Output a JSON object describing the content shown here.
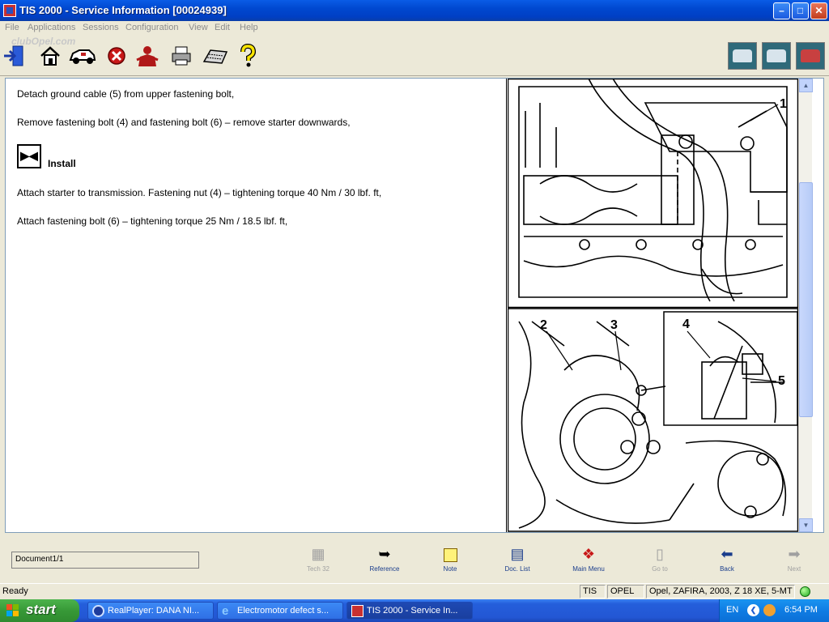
{
  "window": {
    "title": "TIS 2000 - Service Information [00024939]",
    "controls": {
      "minimize": "–",
      "maximize": "□",
      "close": "✕"
    }
  },
  "menu": [
    "File",
    "Applications",
    "Sessions",
    "Configuration",
    "View",
    "Edit",
    "Help"
  ],
  "watermark": "clubOpel.com",
  "toolbar": {
    "left_icons": [
      "exit-icon",
      "home-icon",
      "vehicle-icon",
      "stop-icon",
      "user-icon",
      "print-icon",
      "keyboard-icon",
      "help-icon"
    ],
    "right_icons": [
      "garage-car-icon",
      "car-service-icon",
      "car-red-icon"
    ]
  },
  "content": {
    "paragraphs": [
      "Detach ground cable (5) from upper fastening bolt,",
      "Remove fastening bolt (4) and fastening bolt (6) – remove starter downwards,",
      "Attach starter to transmission. Fastening nut (4) – tightening torque 40 Nm / 30 lbf. ft,",
      "Attach fastening bolt (6) – tightening torque 25 Nm / 18.5 lbf. ft,"
    ],
    "install_heading": "Install",
    "figure_labels": [
      "1",
      "2",
      "3",
      "4",
      "5"
    ]
  },
  "navigation": {
    "document_indicator": "Document1/1",
    "buttons": [
      {
        "label": "Tech 32",
        "icon": "calculator-icon",
        "enabled": false
      },
      {
        "label": "Reference",
        "icon": "reference-arrow-icon",
        "enabled": true
      },
      {
        "label": "Note",
        "icon": "note-icon",
        "enabled": true
      },
      {
        "label": "Doc. List",
        "icon": "document-list-icon",
        "enabled": true
      },
      {
        "label": "Main Menu",
        "icon": "main-menu-icon",
        "enabled": true
      },
      {
        "label": "Go to",
        "icon": "goto-icon",
        "enabled": false
      },
      {
        "label": "Back",
        "icon": "back-arrow-icon",
        "enabled": true
      },
      {
        "label": "Next",
        "icon": "next-arrow-icon",
        "enabled": false
      }
    ]
  },
  "status": {
    "text": "Ready",
    "cells": [
      "TIS",
      "OPEL",
      "Opel, ZAFIRA, 2003, Z 18 XE, 5-MT"
    ]
  },
  "taskbar": {
    "start_label": "start",
    "tasks": [
      {
        "label": "RealPlayer: DANA NI...",
        "icon": "realplayer-icon"
      },
      {
        "label": "Electromotor defect s...",
        "icon": "internet-explorer-icon"
      },
      {
        "label": "TIS 2000 - Service In...",
        "icon": "tis-app-icon"
      }
    ],
    "tray": {
      "language": "EN",
      "time": "6:54 PM"
    }
  }
}
